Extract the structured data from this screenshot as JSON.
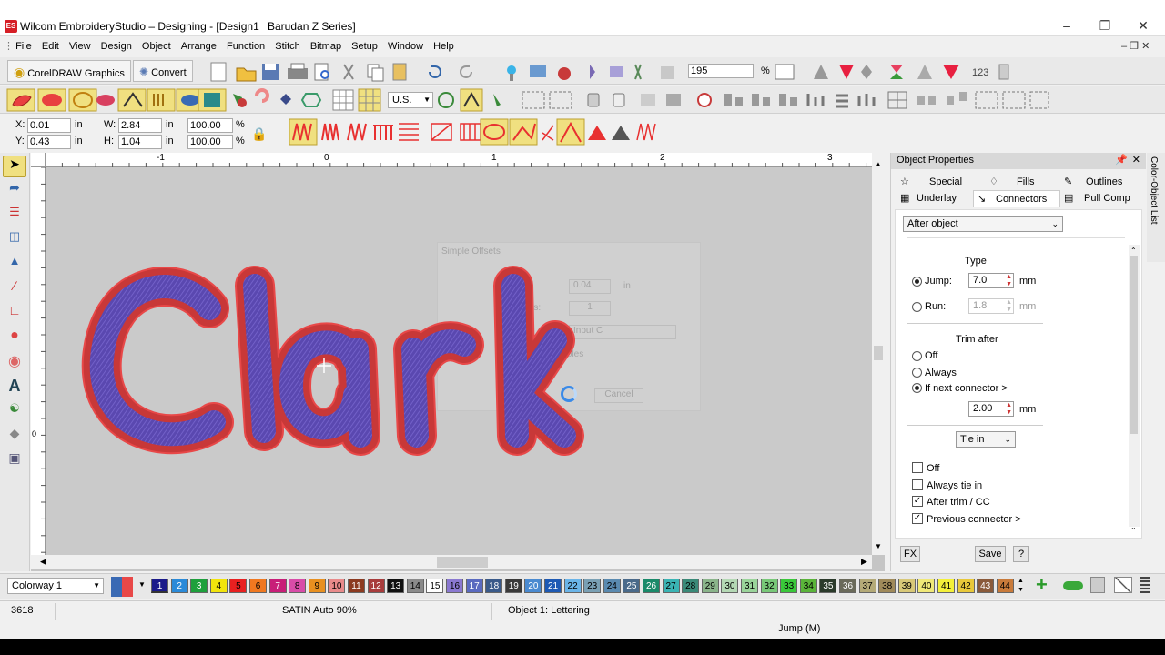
{
  "window": {
    "title": "Wilcom EmbroideryStudio – Designing - [Design1",
    "machine": "Barudan Z Series]",
    "app_badge": "ES"
  },
  "menu": [
    "File",
    "Edit",
    "View",
    "Design",
    "Object",
    "Arrange",
    "Function",
    "Stitch",
    "Bitmap",
    "Setup",
    "Window",
    "Help"
  ],
  "toolbar1": {
    "coreldraw_label": "CorelDRAW Graphics",
    "convert_label": "Convert",
    "zoom_value": "195",
    "zoom_unit": "%"
  },
  "toolbar2": {
    "units": "U.S."
  },
  "position": {
    "x_label": "X:",
    "x_value": "0.01",
    "x_unit": "in",
    "y_label": "Y:",
    "y_value": "0.43",
    "y_unit": "in",
    "w_label": "W:",
    "w_value": "2.84",
    "w_unit": "in",
    "h_label": "H:",
    "h_value": "1.04",
    "h_unit": "in",
    "w_pct": "100.00",
    "h_pct": "100.00",
    "pct_unit": "%"
  },
  "ruler": {
    "labels": [
      "-1",
      "0",
      "1",
      "2",
      "3"
    ],
    "left_labels": [
      "0"
    ]
  },
  "canvas": {
    "lettering": "Clark"
  },
  "ghost_dialog": {
    "title": "Simple Offsets",
    "value1": "0.04",
    "unit1": "in",
    "label2": "of offsets:",
    "value2": "1",
    "label3": "Input C",
    "label4": "e holes",
    "cancel": "Cancel"
  },
  "properties": {
    "title": "Object Properties",
    "tabs_row1": [
      "Special",
      "Fills",
      "Outlines"
    ],
    "tabs_row2": [
      "Underlay",
      "Connectors",
      "Pull Comp"
    ],
    "dropdown": "After object",
    "type_label": "Type",
    "jump_label": "Jump:",
    "jump_value": "7.0",
    "jump_unit": "mm",
    "run_label": "Run:",
    "run_value": "1.8",
    "run_unit": "mm",
    "trim_after_label": "Trim after",
    "trim_off": "Off",
    "trim_always": "Always",
    "trim_if_next": "If next connector >",
    "trim_value": "2.00",
    "trim_unit": "mm",
    "tie_in_dropdown": "Tie in",
    "tie_off": "Off",
    "always_tie_in": "Always tie in",
    "after_trim": "After trim / CC",
    "previous_connector": "Previous connector >",
    "fx_button": "FX",
    "save_button": "Save",
    "help_button": "?"
  },
  "side_tab_label": "Color-Object List",
  "colorway": {
    "label": "Colorway 1",
    "swatches": [
      {
        "n": "1",
        "c": "#1a1a8a",
        "t": "#fff"
      },
      {
        "n": "2",
        "c": "#2a8ad8",
        "t": "#fff"
      },
      {
        "n": "3",
        "c": "#1ea03c",
        "t": "#fff"
      },
      {
        "n": "4",
        "c": "#f2e40c",
        "t": "#000"
      },
      {
        "n": "5",
        "c": "#e82020",
        "t": "#000"
      },
      {
        "n": "6",
        "c": "#f07820",
        "t": "#000"
      },
      {
        "n": "7",
        "c": "#c81e78",
        "t": "#fff"
      },
      {
        "n": "8",
        "c": "#d84ca8",
        "t": "#000"
      },
      {
        "n": "9",
        "c": "#e89020",
        "t": "#000"
      },
      {
        "n": "10",
        "c": "#e88a8a",
        "t": "#000"
      },
      {
        "n": "11",
        "c": "#8c3a20",
        "t": "#fff"
      },
      {
        "n": "12",
        "c": "#a83c3c",
        "t": "#fff"
      },
      {
        "n": "13",
        "c": "#101010",
        "t": "#fff"
      },
      {
        "n": "14",
        "c": "#8a8a8a",
        "t": "#000"
      },
      {
        "n": "15",
        "c": "#ffffff",
        "t": "#000"
      },
      {
        "n": "16",
        "c": "#8a78d0",
        "t": "#000"
      },
      {
        "n": "17",
        "c": "#5a6ac0",
        "t": "#fff"
      },
      {
        "n": "18",
        "c": "#3a5a8a",
        "t": "#fff"
      },
      {
        "n": "19",
        "c": "#3a3a3a",
        "t": "#fff"
      },
      {
        "n": "20",
        "c": "#4a8ad0",
        "t": "#fff"
      },
      {
        "n": "21",
        "c": "#1e5ab4",
        "t": "#fff"
      },
      {
        "n": "22",
        "c": "#6ab4e8",
        "t": "#000"
      },
      {
        "n": "23",
        "c": "#7aa0b4",
        "t": "#000"
      },
      {
        "n": "24",
        "c": "#5a8ab0",
        "t": "#000"
      },
      {
        "n": "25",
        "c": "#4a6a8a",
        "t": "#fff"
      },
      {
        "n": "26",
        "c": "#1a8a6a",
        "t": "#fff"
      },
      {
        "n": "27",
        "c": "#3ab4b4",
        "t": "#000"
      },
      {
        "n": "28",
        "c": "#3a8a78",
        "t": "#000"
      },
      {
        "n": "29",
        "c": "#8ab48a",
        "t": "#000"
      },
      {
        "n": "30",
        "c": "#b4d8b4",
        "t": "#000"
      },
      {
        "n": "31",
        "c": "#9ad49a",
        "t": "#000"
      },
      {
        "n": "32",
        "c": "#78c878",
        "t": "#000"
      },
      {
        "n": "33",
        "c": "#3ac83a",
        "t": "#000"
      },
      {
        "n": "34",
        "c": "#5ab43a",
        "t": "#000"
      },
      {
        "n": "35",
        "c": "#2a3a2a",
        "t": "#fff"
      },
      {
        "n": "36",
        "c": "#6a6a5a",
        "t": "#fff"
      },
      {
        "n": "37",
        "c": "#b4aa78",
        "t": "#000"
      },
      {
        "n": "38",
        "c": "#a08a5a",
        "t": "#000"
      },
      {
        "n": "39",
        "c": "#d8c878",
        "t": "#000"
      },
      {
        "n": "40",
        "c": "#f0e878",
        "t": "#000"
      },
      {
        "n": "41",
        "c": "#f4f03a",
        "t": "#000"
      },
      {
        "n": "42",
        "c": "#e8c83a",
        "t": "#000"
      },
      {
        "n": "43",
        "c": "#8a5a3a",
        "t": "#fff"
      },
      {
        "n": "44",
        "c": "#c87a3a",
        "t": "#000"
      }
    ]
  },
  "status": {
    "stitch_count": "3618",
    "stitch_type": "SATIN Auto 90%",
    "object": "Object 1: Lettering",
    "connector": "Jump (M)"
  }
}
